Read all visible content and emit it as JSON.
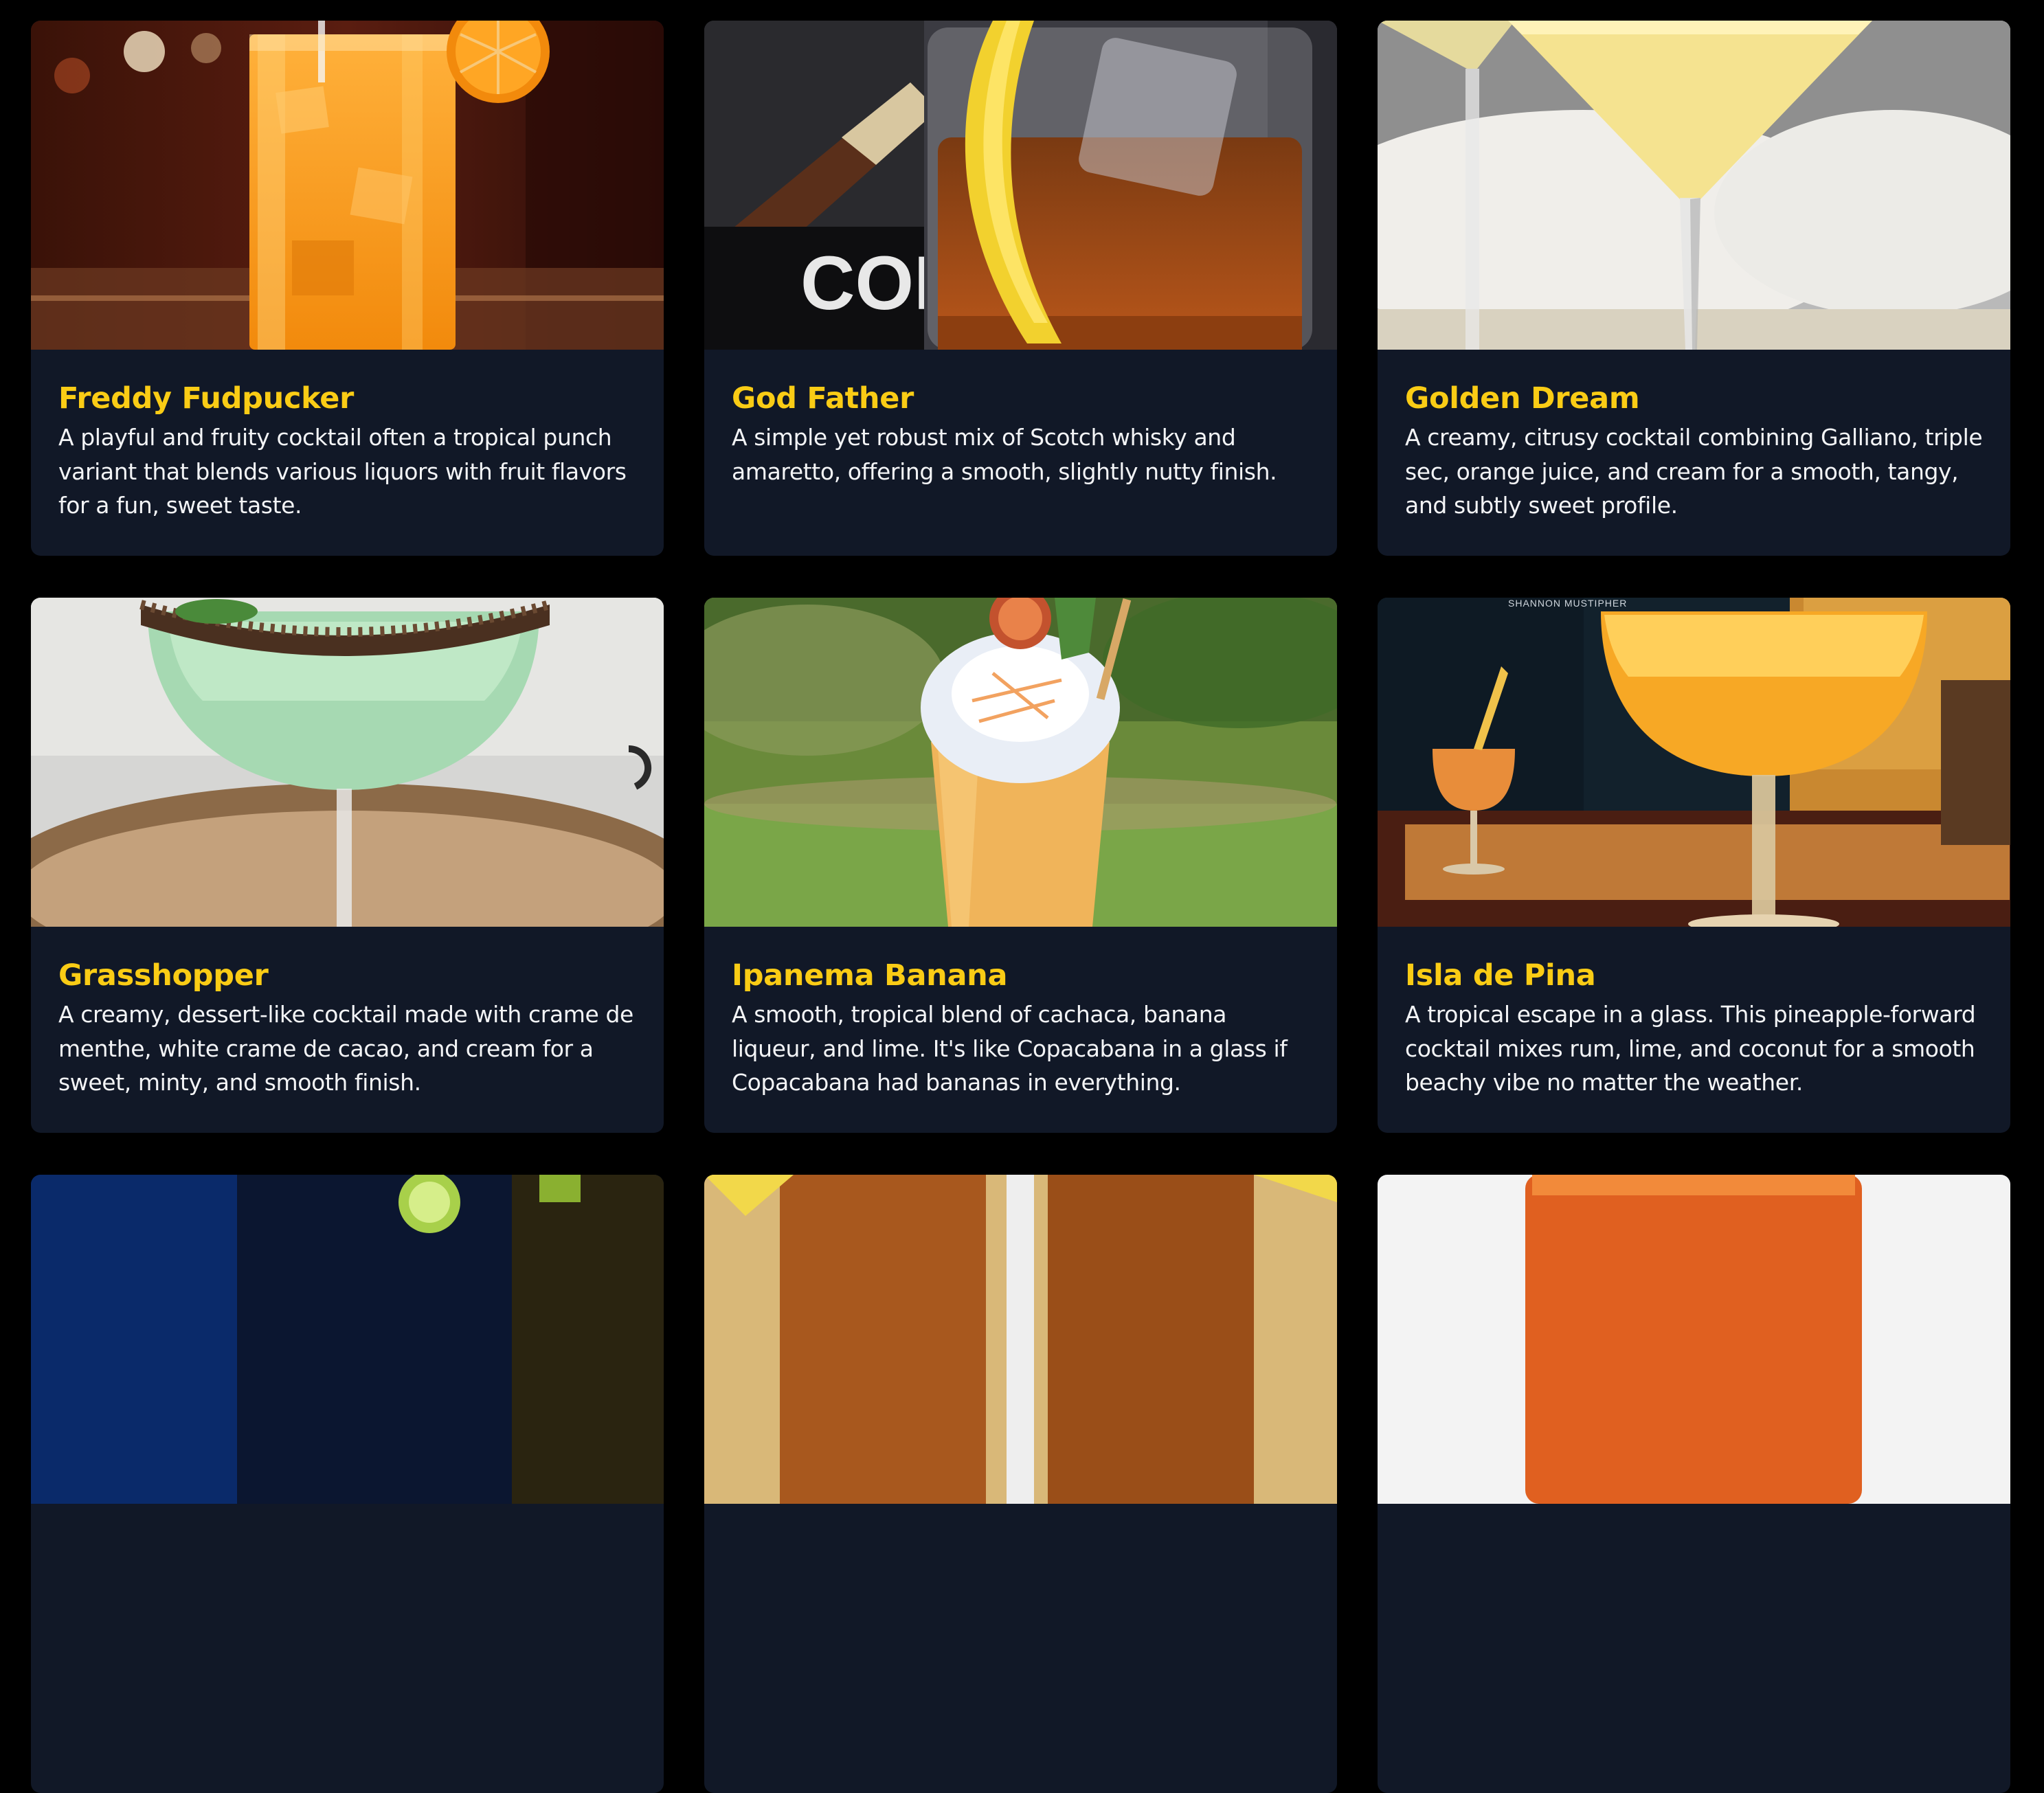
{
  "colors": {
    "page_background": "#000000",
    "card_background": "#111827",
    "title_color": "#facc15",
    "text_color": "#f3f4f6"
  },
  "cocktails": [
    {
      "name": "Freddy Fudpucker",
      "description": "A playful and fruity cocktail often a tropical punch variant that blends various liquors with fruit flavors for a fun, sweet taste.",
      "image": "orange-highball-photo"
    },
    {
      "name": "God Father",
      "description": "A simple yet robust mix of Scotch whisky and amaretto, offering a smooth, slightly nutty finish.",
      "image": "whisky-rocks-glass-cigar-photo"
    },
    {
      "name": "Golden Dream",
      "description": "A creamy, citrusy cocktail combining Galliano, triple sec, orange juice, and cream for a smooth, tangy, and subtly sweet profile.",
      "image": "yellow-martini-glasses-photo"
    },
    {
      "name": "Grasshopper",
      "description": "A creamy, dessert-like cocktail made with crame de menthe, white crame de cacao, and cream for a sweet, minty, and smooth finish.",
      "image": "green-coupe-chocolate-rim-photo"
    },
    {
      "name": "Ipanema Banana",
      "description": "A smooth, tropical blend of cachaca, banana liqueur, and lime. It's like Copacabana in a glass if Copacabana had bananas in everything.",
      "image": "whipped-cream-tiki-glass-photo"
    },
    {
      "name": "Isla de Pina",
      "description": "A tropical escape in a glass. This pineapple-forward cocktail mixes rum, lime, and coconut for a smooth beachy vibe no matter the weather.",
      "image": "yellow-coupe-bar-photo",
      "image_caption": "SHANNON MUSTIPHER"
    }
  ],
  "partial_cards": [
    {
      "image": "green-garnish-dark-bar-photo"
    },
    {
      "image": "amber-glasses-lemon-photo"
    },
    {
      "image": "red-cocktail-white-background-photo"
    }
  ]
}
